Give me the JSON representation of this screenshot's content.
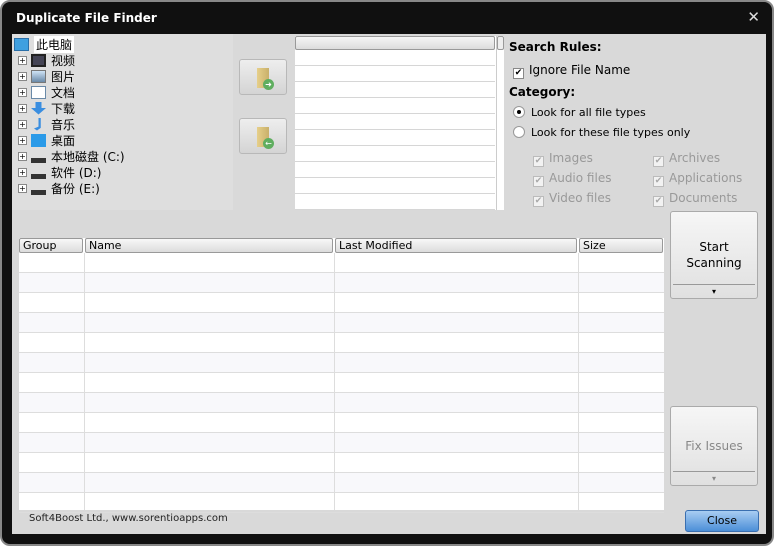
{
  "window": {
    "title": "Duplicate File Finder",
    "close_glyph": "✕"
  },
  "tree": {
    "items": [
      {
        "label": "此电脑",
        "icon": "computer-icon"
      },
      {
        "label": "视频",
        "icon": "video-icon"
      },
      {
        "label": "图片",
        "icon": "picture-icon"
      },
      {
        "label": "文档",
        "icon": "document-icon"
      },
      {
        "label": "下载",
        "icon": "download-icon"
      },
      {
        "label": "音乐",
        "icon": "music-icon"
      },
      {
        "label": "桌面",
        "icon": "desktop-icon"
      },
      {
        "label": "本地磁盘 (C:)",
        "icon": "drive-icon"
      },
      {
        "label": "软件 (D:)",
        "icon": "drive-icon"
      },
      {
        "label": "备份 (E:)",
        "icon": "drive-icon"
      }
    ]
  },
  "rules": {
    "search_rules_heading": "Search Rules:",
    "ignore_file_name": "Ignore File Name",
    "category_heading": "Category:",
    "radio_all": "Look for all file types",
    "radio_only": "Look for these file types only",
    "types": [
      "Images",
      "Archives",
      "Audio files",
      "Applications",
      "Video files",
      "Documents"
    ]
  },
  "table": {
    "columns": [
      "Group",
      "Name",
      "Last Modified",
      "Size"
    ]
  },
  "buttons": {
    "start_line1": "Start",
    "start_line2": "Scanning",
    "fix": "Fix Issues",
    "close": "Close",
    "dropdown_glyph": "▾",
    "add_glyph": "➜",
    "remove_glyph": "←"
  },
  "footer": {
    "text": "Soft4Boost Ltd., www.sorentioapps.com"
  }
}
